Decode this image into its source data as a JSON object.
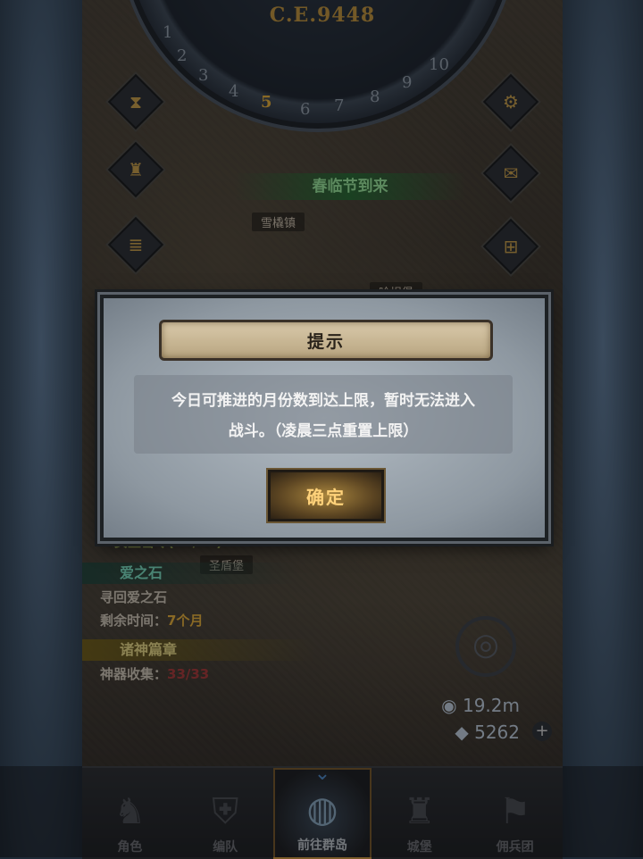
{
  "game": {
    "year": "C.E.9448",
    "dial_numbers": [
      "1",
      "2",
      "3",
      "4",
      "5",
      "6",
      "7",
      "8",
      "9",
      "10"
    ],
    "active_month": "5",
    "event_banner": "春临节到来",
    "towns": [
      "雪橇镇",
      "哈坦堡",
      "圣盾堡"
    ],
    "quests": {
      "q1_title": "女王密令(29/24)",
      "love_title": "爱之石",
      "love_desc": "寻回爱之石",
      "remain_label": "剩余时间：",
      "remain_value": "7个月",
      "god_title": "诸神篇章",
      "artifact_label": "神器收集：",
      "artifact_value": "33/33"
    },
    "resources": {
      "distance": "19.2m",
      "gems": "5262"
    }
  },
  "nav": {
    "items": [
      {
        "label": "角色",
        "icon": "knight-icon"
      },
      {
        "label": "编队",
        "icon": "helmet-icon"
      },
      {
        "label": "前往群岛",
        "icon": "globe-icon"
      },
      {
        "label": "城堡",
        "icon": "castle-icon"
      },
      {
        "label": "佣兵团",
        "icon": "banner-icon"
      }
    ],
    "active_index": 2
  },
  "dialog": {
    "title": "提示",
    "message_line1": "今日可推进的月份数到达上限，暂时无法进入",
    "message_line2": "战斗。（凌晨三点重置上限）",
    "confirm": "确定"
  },
  "colors": {
    "accent_gold": "#f0b63a",
    "event_green": "#9ff0a0",
    "quest_green": "#7fe8c8",
    "quest_yellow": "#f3e28a"
  }
}
